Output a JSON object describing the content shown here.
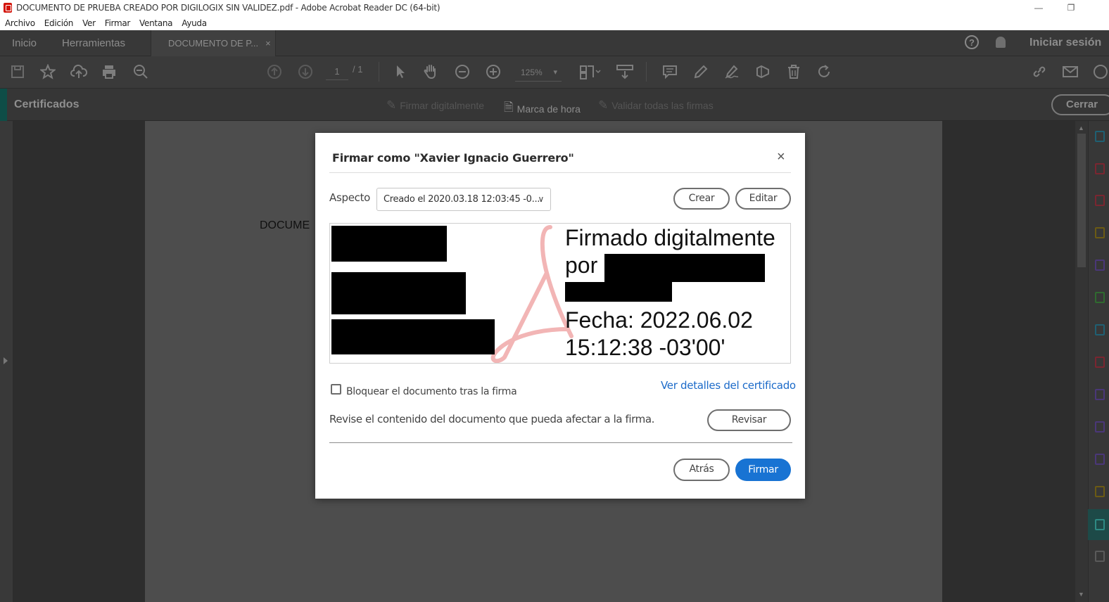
{
  "window": {
    "title": "DOCUMENTO DE PRUEBA CREADO POR DIGILOGIX SIN VALIDEZ.pdf - Adobe Acrobat Reader DC (64-bit)",
    "minimize": "—",
    "restore": "❐"
  },
  "menu": [
    "Archivo",
    "Edición",
    "Ver",
    "Firmar",
    "Ventana",
    "Ayuda"
  ],
  "tabs": {
    "home": "Inicio",
    "tools": "Herramientas",
    "document": "DOCUMENTO DE P...",
    "document_close": "×"
  },
  "account": {
    "help": "?",
    "signin": "Iniciar sesión"
  },
  "toolbar": {
    "page_current": "1",
    "page_total": "/ 1",
    "zoom": "125%"
  },
  "certificates_bar": {
    "title": "Certificados",
    "sign_digitally": "Firmar digitalmente",
    "timestamp": "Marca de hora",
    "validate_all": "Validar todas las firmas",
    "close": "Cerrar"
  },
  "document": {
    "visible_text": "DOCUME"
  },
  "dialog": {
    "title": "Firmar como \"Xavier Ignacio Guerrero\"",
    "close": "×",
    "appearance_label": "Aspecto",
    "appearance_value": "Creado el 2020.03.18 12:03:45 -0...",
    "create": "Crear",
    "edit": "Editar",
    "signature_lines": [
      "Firmado digitalmente",
      "por",
      "Fecha: 2022.06.02",
      "15:12:38 -03'00'"
    ],
    "lock_label": "Bloquear el documento tras la firma",
    "lock_checked": false,
    "cert_details": "Ver detalles del certificado",
    "review_text": "Revise el contenido del documento que pueda afectar a la firma.",
    "review": "Revisar",
    "back": "Atrás",
    "sign": "Firmar"
  },
  "colors": {
    "primary": "#1873d3",
    "link": "#1b6ac9",
    "cert_accent": "#0e4d47"
  }
}
